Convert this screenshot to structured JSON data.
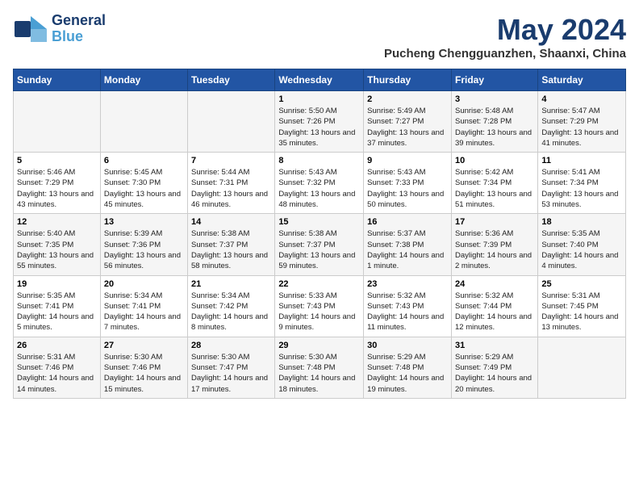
{
  "header": {
    "logo_line1": "General",
    "logo_line2": "Blue",
    "month_title": "May 2024",
    "location": "Pucheng Chengguanzhen, Shaanxi, China"
  },
  "weekdays": [
    "Sunday",
    "Monday",
    "Tuesday",
    "Wednesday",
    "Thursday",
    "Friday",
    "Saturday"
  ],
  "weeks": [
    [
      {
        "day": "",
        "info": ""
      },
      {
        "day": "",
        "info": ""
      },
      {
        "day": "",
        "info": ""
      },
      {
        "day": "1",
        "info": "Sunrise: 5:50 AM\nSunset: 7:26 PM\nDaylight: 13 hours and 35 minutes."
      },
      {
        "day": "2",
        "info": "Sunrise: 5:49 AM\nSunset: 7:27 PM\nDaylight: 13 hours and 37 minutes."
      },
      {
        "day": "3",
        "info": "Sunrise: 5:48 AM\nSunset: 7:28 PM\nDaylight: 13 hours and 39 minutes."
      },
      {
        "day": "4",
        "info": "Sunrise: 5:47 AM\nSunset: 7:29 PM\nDaylight: 13 hours and 41 minutes."
      }
    ],
    [
      {
        "day": "5",
        "info": "Sunrise: 5:46 AM\nSunset: 7:29 PM\nDaylight: 13 hours and 43 minutes."
      },
      {
        "day": "6",
        "info": "Sunrise: 5:45 AM\nSunset: 7:30 PM\nDaylight: 13 hours and 45 minutes."
      },
      {
        "day": "7",
        "info": "Sunrise: 5:44 AM\nSunset: 7:31 PM\nDaylight: 13 hours and 46 minutes."
      },
      {
        "day": "8",
        "info": "Sunrise: 5:43 AM\nSunset: 7:32 PM\nDaylight: 13 hours and 48 minutes."
      },
      {
        "day": "9",
        "info": "Sunrise: 5:43 AM\nSunset: 7:33 PM\nDaylight: 13 hours and 50 minutes."
      },
      {
        "day": "10",
        "info": "Sunrise: 5:42 AM\nSunset: 7:34 PM\nDaylight: 13 hours and 51 minutes."
      },
      {
        "day": "11",
        "info": "Sunrise: 5:41 AM\nSunset: 7:34 PM\nDaylight: 13 hours and 53 minutes."
      }
    ],
    [
      {
        "day": "12",
        "info": "Sunrise: 5:40 AM\nSunset: 7:35 PM\nDaylight: 13 hours and 55 minutes."
      },
      {
        "day": "13",
        "info": "Sunrise: 5:39 AM\nSunset: 7:36 PM\nDaylight: 13 hours and 56 minutes."
      },
      {
        "day": "14",
        "info": "Sunrise: 5:38 AM\nSunset: 7:37 PM\nDaylight: 13 hours and 58 minutes."
      },
      {
        "day": "15",
        "info": "Sunrise: 5:38 AM\nSunset: 7:37 PM\nDaylight: 13 hours and 59 minutes."
      },
      {
        "day": "16",
        "info": "Sunrise: 5:37 AM\nSunset: 7:38 PM\nDaylight: 14 hours and 1 minute."
      },
      {
        "day": "17",
        "info": "Sunrise: 5:36 AM\nSunset: 7:39 PM\nDaylight: 14 hours and 2 minutes."
      },
      {
        "day": "18",
        "info": "Sunrise: 5:35 AM\nSunset: 7:40 PM\nDaylight: 14 hours and 4 minutes."
      }
    ],
    [
      {
        "day": "19",
        "info": "Sunrise: 5:35 AM\nSunset: 7:41 PM\nDaylight: 14 hours and 5 minutes."
      },
      {
        "day": "20",
        "info": "Sunrise: 5:34 AM\nSunset: 7:41 PM\nDaylight: 14 hours and 7 minutes."
      },
      {
        "day": "21",
        "info": "Sunrise: 5:34 AM\nSunset: 7:42 PM\nDaylight: 14 hours and 8 minutes."
      },
      {
        "day": "22",
        "info": "Sunrise: 5:33 AM\nSunset: 7:43 PM\nDaylight: 14 hours and 9 minutes."
      },
      {
        "day": "23",
        "info": "Sunrise: 5:32 AM\nSunset: 7:43 PM\nDaylight: 14 hours and 11 minutes."
      },
      {
        "day": "24",
        "info": "Sunrise: 5:32 AM\nSunset: 7:44 PM\nDaylight: 14 hours and 12 minutes."
      },
      {
        "day": "25",
        "info": "Sunrise: 5:31 AM\nSunset: 7:45 PM\nDaylight: 14 hours and 13 minutes."
      }
    ],
    [
      {
        "day": "26",
        "info": "Sunrise: 5:31 AM\nSunset: 7:46 PM\nDaylight: 14 hours and 14 minutes."
      },
      {
        "day": "27",
        "info": "Sunrise: 5:30 AM\nSunset: 7:46 PM\nDaylight: 14 hours and 15 minutes."
      },
      {
        "day": "28",
        "info": "Sunrise: 5:30 AM\nSunset: 7:47 PM\nDaylight: 14 hours and 17 minutes."
      },
      {
        "day": "29",
        "info": "Sunrise: 5:30 AM\nSunset: 7:48 PM\nDaylight: 14 hours and 18 minutes."
      },
      {
        "day": "30",
        "info": "Sunrise: 5:29 AM\nSunset: 7:48 PM\nDaylight: 14 hours and 19 minutes."
      },
      {
        "day": "31",
        "info": "Sunrise: 5:29 AM\nSunset: 7:49 PM\nDaylight: 14 hours and 20 minutes."
      },
      {
        "day": "",
        "info": ""
      }
    ]
  ]
}
